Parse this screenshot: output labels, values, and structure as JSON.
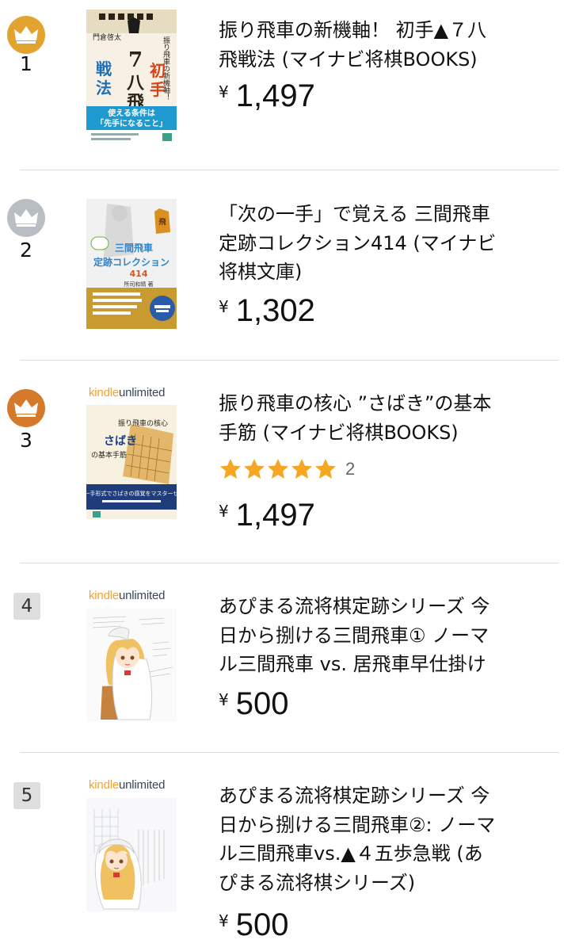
{
  "colors": {
    "gold": "#e3a42f",
    "silver": "#b9bec4",
    "bronze": "#d47a2a",
    "star": "#f5a623",
    "divider": "#dddddd",
    "rank_box": "#dedede"
  },
  "currency_symbol": "¥",
  "items": [
    {
      "rank": "1",
      "badge": "gold-crown",
      "title_lines": [
        "振り飛車の新機軸！ 初手▲７八",
        "飛戦法 (マイナビ将棋BOOKS)"
      ],
      "price": "1,497",
      "cover": {
        "kind": "shogi-book-cover",
        "text_a": "振り飛車の新機軸！",
        "text_b": "初手",
        "text_c": "7八飛",
        "text_d": "戦法",
        "text_e": "門倉啓太",
        "text_f": "使える条件は「先手になること」"
      }
    },
    {
      "rank": "2",
      "badge": "silver-crown",
      "title_lines": [
        "「次の一手」で覚える 三間飛車",
        "定跡コレクション414 (マイナビ",
        "将棋文庫)"
      ],
      "price": "1,302",
      "cover": {
        "kind": "shogi-book-cover",
        "text_a": "三間飛車",
        "text_b": "定跡コレクション",
        "text_c": "414",
        "text_d": "所司和晴 著"
      }
    },
    {
      "rank": "3",
      "badge": "bronze-crown",
      "kindle_unlimited": {
        "kindle": "kindle",
        "unlimited": "unlimited"
      },
      "title_lines": [
        "振り飛車の核心 ”さばき”の基本",
        "手筋 (マイナビ将棋BOOKS)"
      ],
      "rating": {
        "stars": 5,
        "count": "2"
      },
      "price": "1,497",
      "cover": {
        "kind": "shogi-book-cover",
        "text_a": "振り飛車の核心",
        "text_b": "さばき",
        "text_c": "の基本手筋",
        "text_d": "次の一手形式でさばきの感覚をマスターせよ！"
      }
    },
    {
      "rank": "4",
      "badge": "box",
      "kindle_unlimited": {
        "kindle": "kindle",
        "unlimited": "unlimited"
      },
      "title_lines": [
        "あぴまる流将棋定跡シリーズ 今",
        "日から捌ける三間飛車① ノーマ",
        "ル三間飛車 vs. 居飛車早仕掛け"
      ],
      "price": "500",
      "cover": {
        "kind": "illustrated-cover"
      }
    },
    {
      "rank": "5",
      "badge": "box",
      "kindle_unlimited": {
        "kindle": "kindle",
        "unlimited": "unlimited"
      },
      "title_lines": [
        "あぴまる流将棋定跡シリーズ 今",
        "日から捌ける三間飛車②: ノーマ",
        "ル三間飛車vs.▲４五歩急戦 (あ",
        "ぴまる流将棋シリーズ)"
      ],
      "price": "500",
      "cover": {
        "kind": "illustrated-cover"
      }
    }
  ]
}
